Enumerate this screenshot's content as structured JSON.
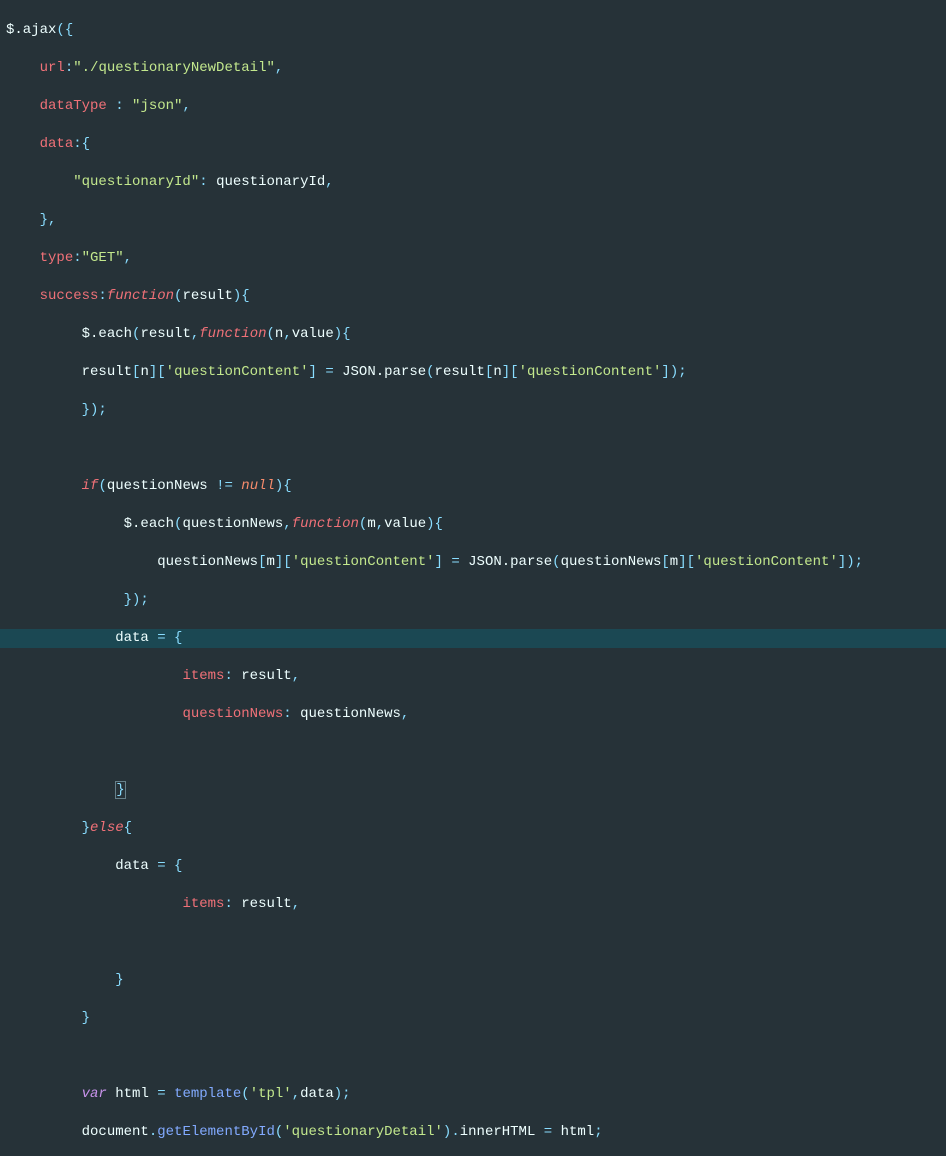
{
  "code": {
    "ajax": "$.ajax",
    "url_key": "url",
    "url_val": "\"./questionaryNewDetail\"",
    "dataType_key": "dataType",
    "dataType_val": "\"json\"",
    "data_key": "data",
    "questionaryId_key": "\"questionaryId\"",
    "questionaryId_val": "questionaryId",
    "type_key": "type",
    "type_val": "\"GET\"",
    "success_key": "success",
    "function_kw": "function",
    "result_param": "result",
    "each": "$.each",
    "n_param": "n",
    "value_param": "value",
    "result_var": "result",
    "questionContent_key": "'questionContent'",
    "json_parse": "JSON.parse",
    "if_kw": "if",
    "questionNews": "questionNews",
    "null_kw": "null",
    "m_param": "m",
    "data_var": "data",
    "items_key": "items",
    "else_kw": "else",
    "var_kw": "var",
    "html_var": "html",
    "template_fn": "template",
    "tpl_str": "'tpl'",
    "document": "document",
    "getElementById": "getElementById",
    "questionaryDetail_str": "'questionaryDetail'",
    "innerHTML": "innerHTML"
  }
}
